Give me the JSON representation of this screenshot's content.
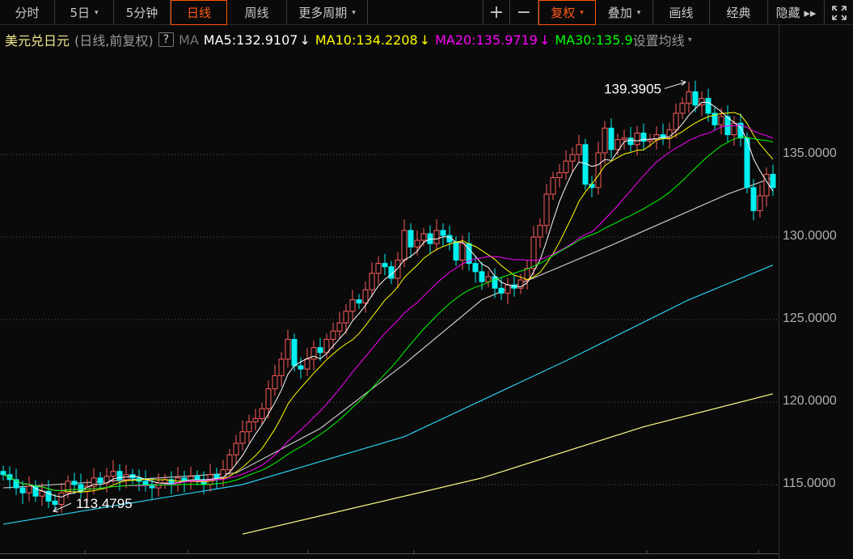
{
  "toolbar": {
    "left": [
      {
        "label": "分时"
      },
      {
        "label": "5日",
        "caret": "▾"
      },
      {
        "label": "5分钟"
      },
      {
        "label": "日线",
        "active": true
      },
      {
        "label": "周线"
      },
      {
        "label": "更多周期",
        "caret": "▾"
      }
    ],
    "zoom_in": "+",
    "zoom_out": "−",
    "right": [
      {
        "label": "复权",
        "caret": "▾",
        "active": true
      },
      {
        "label": "叠加",
        "caret": "▾"
      },
      {
        "label": "画线"
      },
      {
        "label": "经典"
      },
      {
        "label": "隐藏 ▸▸"
      }
    ],
    "fullscreen_icon": "fullscreen-icon"
  },
  "legend": {
    "symbol": "美元兑日元",
    "mode": "(日线,前复权)",
    "help": "?",
    "ma_label": "MA",
    "ma5": "MA5:132.9107",
    "ma10": "MA10:134.2208",
    "ma20": "MA20:135.9719",
    "ma30": "MA30:135.9",
    "arrow": "↓",
    "settings": "设置均线",
    "settings_caret": "▾"
  },
  "colors": {
    "up": "#ff5b5b",
    "down": "#00f0f0",
    "ma5": "#ffffff",
    "ma10": "#ffff00",
    "ma20": "#ff00ff",
    "ma30": "#00ff00",
    "ma60": "#c8c8c8",
    "ma120": "#2ad0f0",
    "ma250": "#ffff88"
  },
  "chart_data": {
    "type": "candlestick",
    "title": "美元兑日元 日线",
    "yticks": [
      "135.0000",
      "130.0000",
      "125.0000",
      "120.0000",
      "115.0000"
    ],
    "ytick_values": [
      135,
      130,
      125,
      120,
      115
    ],
    "ylim": [
      111.5,
      141.2
    ],
    "closes": [
      115.6,
      115.3,
      114.8,
      114.5,
      114.9,
      114.3,
      114.6,
      114.0,
      113.8,
      114.5,
      115.2,
      115.0,
      114.6,
      114.9,
      115.4,
      115.1,
      115.5,
      115.8,
      115.3,
      115.6,
      115.4,
      115.2,
      115.0,
      114.8,
      115.1,
      115.3,
      115.0,
      115.4,
      115.2,
      115.5,
      115.3,
      115.0,
      115.6,
      115.4,
      115.9,
      116.8,
      117.5,
      118.2,
      118.8,
      119.0,
      119.6,
      120.8,
      121.6,
      122.6,
      123.8,
      122.2,
      122.0,
      122.6,
      123.3,
      123.0,
      123.8,
      124.3,
      124.8,
      125.5,
      126.2,
      126.0,
      126.8,
      127.8,
      128.4,
      128.2,
      127.5,
      128.6,
      130.4,
      129.4,
      129.8,
      130.2,
      129.6,
      130.4,
      130.1,
      129.7,
      128.6,
      129.6,
      128.4,
      127.9,
      127.3,
      127.6,
      126.9,
      126.6,
      127.1,
      126.9,
      127.4,
      128.1,
      130.0,
      130.7,
      132.6,
      133.6,
      133.9,
      134.6,
      135.0,
      135.6,
      133.2,
      133.0,
      135.1,
      136.6,
      135.3,
      135.9,
      136.0,
      135.6,
      136.3,
      135.8,
      135.9,
      136.2,
      136.0,
      136.5,
      137.5,
      138.1,
      138.8,
      138.0,
      138.4,
      137.5,
      136.8,
      137.3,
      136.2,
      136.9,
      136.0,
      133.0,
      131.6,
      132.5,
      133.8,
      133.0
    ],
    "first_open": 115.8,
    "annotations": [
      {
        "label": "139.3905",
        "index": 106,
        "value": 139.3905,
        "kind": "high"
      },
      {
        "label": "113.4795",
        "index": 8,
        "value": 113.4795,
        "kind": "low"
      }
    ],
    "computed_ma": [
      {
        "name": "MA5",
        "period": 5
      },
      {
        "name": "MA10",
        "period": 10
      },
      {
        "name": "MA20",
        "period": 20
      },
      {
        "name": "MA30",
        "period": 30
      }
    ],
    "long_ma": [
      {
        "name": "MA60",
        "points": [
          [
            0,
            114.8
          ],
          [
            36,
            115.7
          ],
          [
            49,
            118.4
          ],
          [
            62,
            122.3
          ],
          [
            74,
            126.2
          ],
          [
            94,
            129.5
          ],
          [
            112,
            132.6
          ],
          [
            119,
            133.6
          ]
        ]
      },
      {
        "name": "MA120",
        "points": [
          [
            0,
            112.6
          ],
          [
            37,
            115.0
          ],
          [
            62,
            117.9
          ],
          [
            87,
            122.5
          ],
          [
            106,
            126.2
          ],
          [
            119,
            128.3
          ]
        ]
      },
      {
        "name": "MA250",
        "points": [
          [
            37,
            112.0
          ],
          [
            74,
            115.4
          ],
          [
            99,
            118.5
          ],
          [
            119,
            120.5
          ]
        ]
      }
    ]
  }
}
